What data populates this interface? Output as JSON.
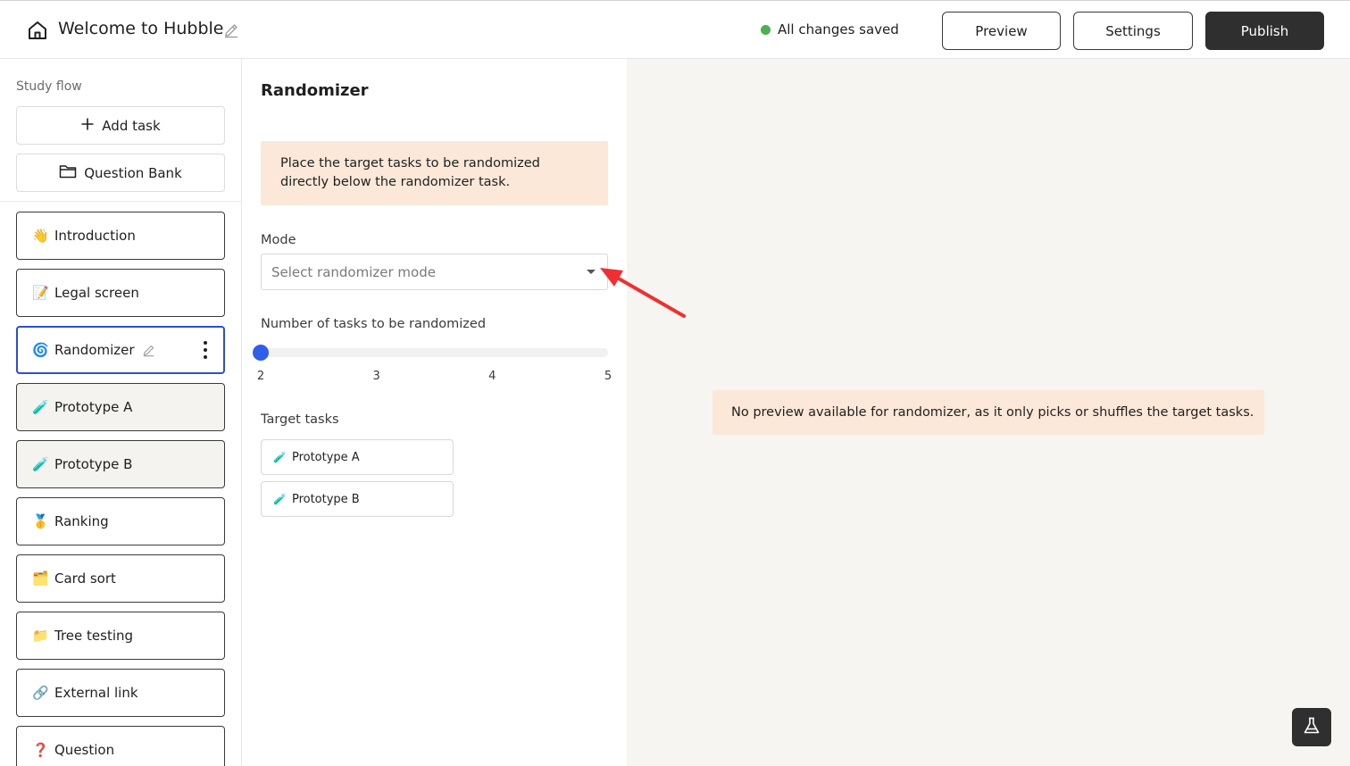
{
  "header": {
    "title": "Welcome to Hubble",
    "save_status": "All changes saved",
    "preview_label": "Preview",
    "settings_label": "Settings",
    "publish_label": "Publish"
  },
  "sidebar": {
    "heading": "Study flow",
    "add_task_label": "Add task",
    "question_bank_label": "Question Bank",
    "tasks": [
      {
        "emoji": "👋",
        "label": "Introduction"
      },
      {
        "emoji": "📝",
        "label": "Legal screen"
      },
      {
        "emoji": "🌀",
        "label": "Randomizer"
      },
      {
        "emoji": "🧪",
        "label": "Prototype A"
      },
      {
        "emoji": "🧪",
        "label": "Prototype B"
      },
      {
        "emoji": "🥇",
        "label": "Ranking"
      },
      {
        "emoji": "🗂️",
        "label": "Card sort"
      },
      {
        "emoji": "📁",
        "label": "Tree testing"
      },
      {
        "emoji": "🔗",
        "label": "External link"
      },
      {
        "emoji": "❓",
        "label": "Question"
      }
    ]
  },
  "panel": {
    "title": "Randomizer",
    "info": "Place the target tasks to be randomized directly below the randomizer task.",
    "mode_label": "Mode",
    "mode_placeholder": "Select randomizer mode",
    "slider_label": "Number of tasks to be randomized",
    "slider_value": 2,
    "slider_ticks": [
      "2",
      "3",
      "4",
      "5"
    ],
    "target_label": "Target tasks",
    "targets": [
      {
        "emoji": "🧪",
        "label": "Prototype A"
      },
      {
        "emoji": "🧪",
        "label": "Prototype B"
      }
    ]
  },
  "preview": {
    "note": "No preview available for randomizer, as it only picks or shuffles the target tasks."
  },
  "colors": {
    "accent_blue": "#2f5ee8",
    "active_border": "#2b4fcf",
    "info_bg": "#fbe8d8",
    "publish_bg": "#2f2f2f",
    "saved_dot": "#4caf50",
    "annotation_arrow": "#f03030"
  },
  "icons": {
    "home": "home-icon",
    "edit": "pencil-icon",
    "add": "plus-icon",
    "bank": "folder-icon",
    "more": "kebab-menu-icon",
    "dropdown": "caret-down-icon",
    "lab": "flask-icon"
  }
}
